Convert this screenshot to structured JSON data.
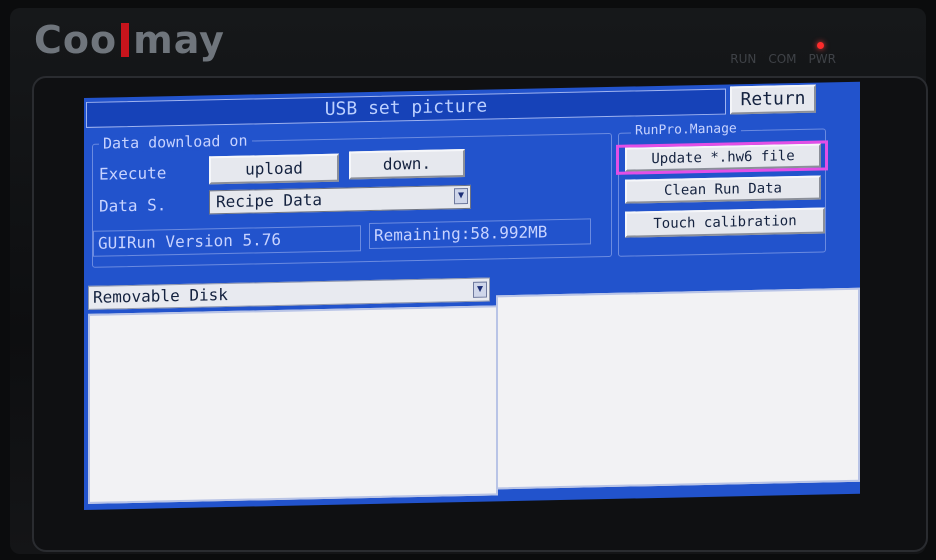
{
  "device": {
    "brand_left": "Coo",
    "brand_right": "may",
    "led_labels": [
      "RUN",
      "COM",
      "PWR"
    ]
  },
  "screen": {
    "title": "USB set picture",
    "return_label": "Return",
    "data_download": {
      "group_title": "Data download on",
      "execute_label": "Execute",
      "upload_label": "upload",
      "down_label": "down.",
      "data_source_label": "Data S.",
      "data_source_value": "Recipe Data",
      "version_text": "GUIRun Version 5.76",
      "remaining_text": "Remaining:58.992MB"
    },
    "runpro": {
      "group_title": "RunPro.Manage",
      "update_label": "Update *.hw6 file",
      "clean_label": "Clean Run Data",
      "touch_label": "Touch calibration"
    },
    "disk": {
      "selected": "Removable Disk"
    }
  },
  "colors": {
    "screen_bg": "#2253cc",
    "highlight": "#e24fe6",
    "pwr_led": "#ff2b2b"
  },
  "icons": {
    "dropdown_arrow": "chevron-down-icon"
  }
}
